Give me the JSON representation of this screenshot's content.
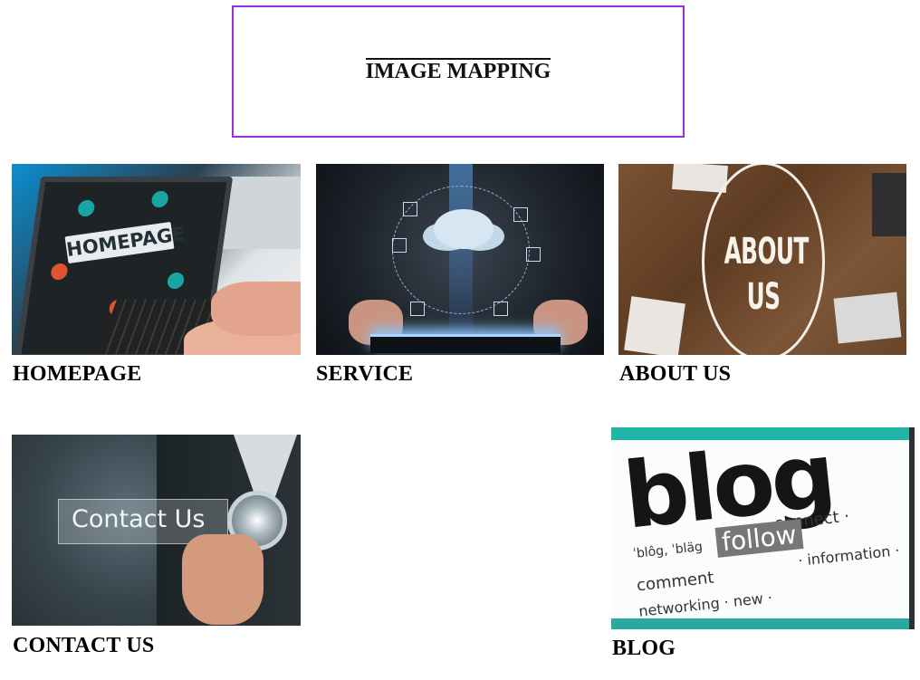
{
  "header": {
    "title": "IMAGE MAPPING"
  },
  "tiles": [
    {
      "caption": "HOMEPAGE",
      "image_text": "HOMEPAGE"
    },
    {
      "caption": "SERVICE"
    },
    {
      "caption": "ABOUT US",
      "image_text": "ABOUT US"
    },
    {
      "caption": "CONTACT US",
      "image_text": "Contact Us"
    },
    {
      "caption": "BLOG",
      "image_text": "blog",
      "image_subtext": "follow"
    }
  ],
  "colors": {
    "title_border": "#9b30d9",
    "text": "#000000"
  }
}
